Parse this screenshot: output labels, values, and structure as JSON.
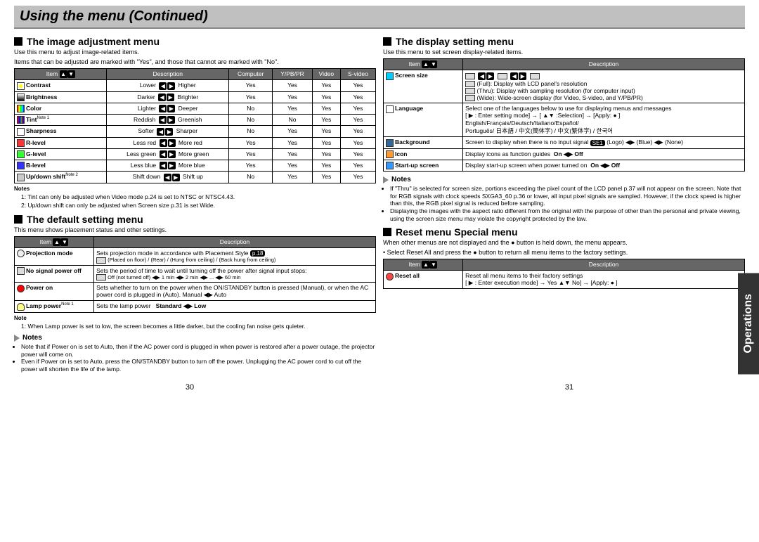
{
  "page_title": "Using the menu (Continued)",
  "side_tab": "Operations",
  "left": {
    "sec1_title": "The image adjustment menu",
    "sec1_intro1": "Use this menu to adjust image-related items.",
    "sec1_intro2": "Items that can be adjusted are marked with \"Yes\", and those that cannot are marked with \"No\".",
    "t1_headers": {
      "item": "Item",
      "desc": "Description",
      "comp": "Computer",
      "ypbpr": "Y/PB/PR",
      "video": "Video",
      "svideo": "S-video"
    },
    "t1_rows": [
      {
        "label": "Contrast",
        "lo": "Lower",
        "hi": "Higher",
        "c": "Yes",
        "y": "Yes",
        "v": "Yes",
        "s": "Yes",
        "icon": "sun"
      },
      {
        "label": "Brightness",
        "lo": "Darker",
        "hi": "Brighter",
        "c": "Yes",
        "y": "Yes",
        "v": "Yes",
        "s": "Yes",
        "icon": "brt"
      },
      {
        "label": "Color",
        "lo": "Lighter",
        "hi": "Deeper",
        "c": "No",
        "y": "Yes",
        "v": "Yes",
        "s": "Yes",
        "icon": "clr"
      },
      {
        "label": "Tint",
        "note": "Note 1",
        "lo": "Reddish",
        "hi": "Greenish",
        "c": "No",
        "y": "No",
        "v": "Yes",
        "s": "Yes",
        "icon": "tint"
      },
      {
        "label": "Sharpness",
        "lo": "Softer",
        "hi": "Sharper",
        "c": "No",
        "y": "Yes",
        "v": "Yes",
        "s": "Yes",
        "icon": "sharp"
      },
      {
        "label": "R-level",
        "lo": "Less red",
        "hi": "More red",
        "c": "Yes",
        "y": "Yes",
        "v": "Yes",
        "s": "Yes",
        "icon": "rlev"
      },
      {
        "label": "G-level",
        "lo": "Less green",
        "hi": "More green",
        "c": "Yes",
        "y": "Yes",
        "v": "Yes",
        "s": "Yes",
        "icon": "glev"
      },
      {
        "label": "B-level",
        "lo": "Less blue",
        "hi": "More blue",
        "c": "Yes",
        "y": "Yes",
        "v": "Yes",
        "s": "Yes",
        "icon": "blev"
      },
      {
        "label": "Up/down shift",
        "note": "Note 2",
        "lo": "Shift down",
        "hi": "Shift up",
        "c": "No",
        "y": "Yes",
        "v": "Yes",
        "s": "Yes",
        "icon": "shift"
      }
    ],
    "notes_label": "Notes",
    "note1": "1:  Tint can only be adjusted when Video mode p.24 is set to NTSC or NTSC4.43.",
    "note2": "2:  Up/down shift can only be adjusted when Screen size p.31 is set Wide.",
    "sec2_title": "The default setting menu",
    "sec2_intro": "This menu shows placement status and other settings.",
    "t2_headers": {
      "item": "Item",
      "desc": "Description"
    },
    "t2_rows": [
      {
        "label": "Projection mode",
        "icon": "proj",
        "desc": "Sets projection mode in accordance with Placement Style",
        "ref": "p.18",
        "sub": "(Placed on floor) / (Rear) / (Hung from ceiling) / (Back hung from ceiling)"
      },
      {
        "label": "No signal power off",
        "icon": "signal",
        "desc": "Sets the period of time to wait until turning off the power after signal input stops:",
        "sub": "Off (not turned off) ◀▶ 1 min ◀▶ 2 min ◀▶ ... ◀▶ 60 min"
      },
      {
        "label": "Power on",
        "icon": "power",
        "desc": "Sets whether to turn on the power when the ON/STANDBY button is pressed (Manual), or when the AC power cord is plugged in (Auto).  Manual ◀▶ Auto"
      },
      {
        "label": "Lamp power",
        "note": "Note 1",
        "icon": "bulb",
        "desc": "Sets the lamp power",
        "suffix": "Standard ◀▶ Low"
      }
    ],
    "note_b_label": "Note",
    "note_b": "1:  When Lamp power is set to low, the screen becomes a little darker, but the cooling fan noise gets quieter.",
    "notes_c_label": "Notes",
    "notes_c": [
      "Note that if Power on is set to Auto, then if the AC power cord is plugged in when power is restored after a power outage, the projector power will come on.",
      "Even if Power on is set to Auto, press the ON/STANDBY button to turn off the power. Unplugging the AC power cord to cut off the power will shorten the life of the lamp."
    ]
  },
  "right": {
    "sec1_title": "The display setting menu",
    "sec1_intro": "Use this menu to set screen display-related items.",
    "t3_headers": {
      "item": "Item",
      "desc": "Description"
    },
    "t3_rows": [
      {
        "label": "Screen size",
        "icon": "scr",
        "opts": [
          "(Full): Display with LCD panel's resolution",
          "(Thru): Display with sampling resolution (for computer input)",
          "(Wide): Wide-screen display (for Video, S-video, and Y/PB/PR)"
        ]
      },
      {
        "label": "Language",
        "icon": "lang",
        "desc": "Select one of the languages below to use for displaying menus and messages",
        "hint": "[ ▶ : Enter setting mode] → [ ▲▼ :Selection] → [Apply: ● ]",
        "langs": "English/Français/Deutsch/Italiano/Español/\nPortuguês/ 日本語 / 中文(簡体字) / 中文(繁体字) / 한국어"
      },
      {
        "label": "Background",
        "icon": "bg",
        "desc": "Screen to display when there is no input signal",
        "opts_line": "(Logo) ◀▶ (Blue) ◀▶ (None)"
      },
      {
        "label": "Icon",
        "icon": "ico",
        "desc": "Display icons as function guides",
        "suffix": "On ◀▶ Off"
      },
      {
        "label": "Start-up screen",
        "icon": "start",
        "desc": "Display start-up screen when power turned on",
        "suffix": "On ◀▶ Off"
      }
    ],
    "notes_label": "Notes",
    "notes": [
      "If \"Thru\" is selected for screen size, portions exceeding the pixel count of the LCD panel p.37 will not appear on the screen. Note that for RGB signals with clock speeds SXGA3_60 p.36 or lower, all input pixel signals are sampled. However, if the clock speed is higher than this, the RGB pixel signal is reduced before sampling.",
      "Displaying the images with the aspect ratio different from the original with the purpose of other than the personal and private viewing, using the screen size menu may violate the copyright protected by the law."
    ],
    "sec2_title": "Reset menu Special menu",
    "sec2_intro1": "When other menus are not displayed and the ● button is held down, the menu appears.",
    "sec2_intro2": "• Select Reset All and press the ● button to return all menu items to the factory settings.",
    "t4_headers": {
      "item": "Item",
      "desc": "Description"
    },
    "t4_row": {
      "label": "Reset all",
      "icon": "reset",
      "desc": "Reset all menu items to their factory settings",
      "hint": "[ ▶ : Enter execution mode] → Yes ▲▼ No] → [Apply: ● ]"
    }
  },
  "page_left": "30",
  "page_right": "31"
}
